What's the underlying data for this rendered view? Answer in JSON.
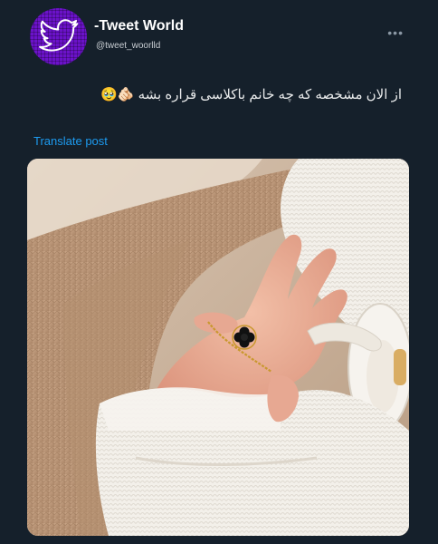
{
  "author": {
    "display_name": "-Tweet World",
    "handle": "@tweet_woorlld",
    "avatar_icon": "bird-icon"
  },
  "menu": {
    "more_label": "•••"
  },
  "tweet": {
    "text": "از الان مشخصه که چه خانم باکلاسی قراره بشه 🫵🏻🥹",
    "translate_label": "Translate post"
  },
  "colors": {
    "background": "#15202b",
    "link": "#1d9bf0",
    "avatar": "#6b12c9"
  }
}
